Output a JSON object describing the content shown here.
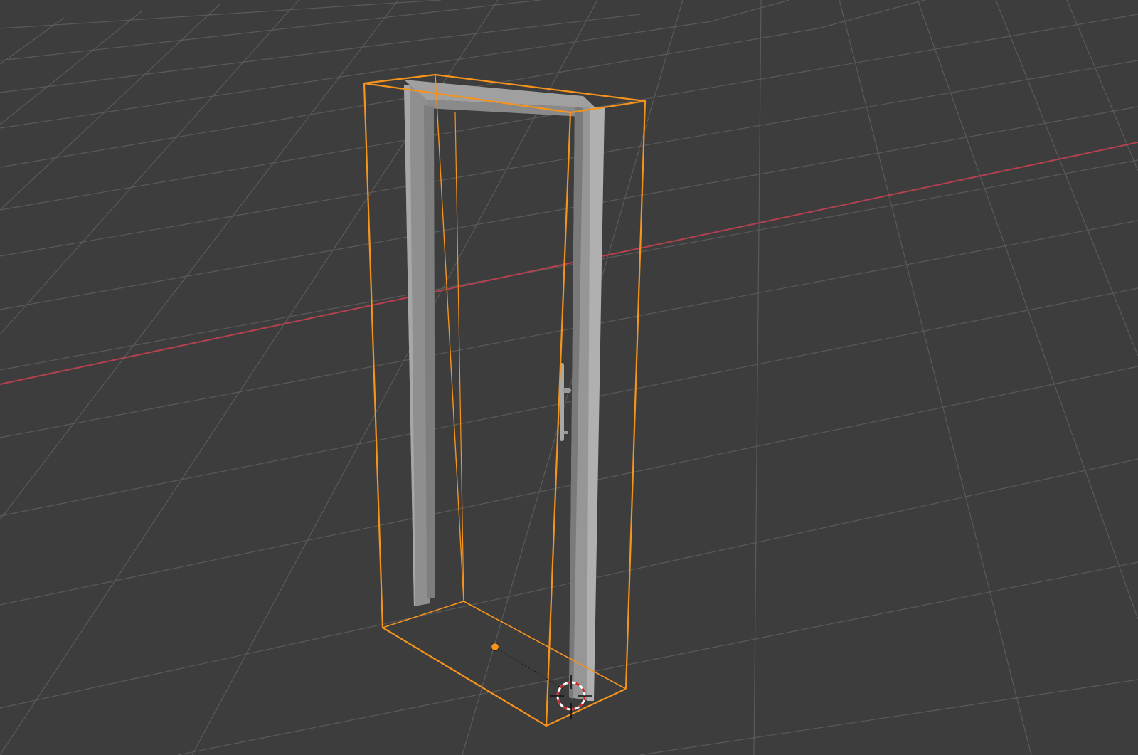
{
  "app": {
    "editor": "3D Viewport"
  },
  "scene": {
    "background_color": "#3d3d3d",
    "grid_color": "#5a5a5a",
    "x_axis_color": "#b5404f",
    "selected_outline_color": "#f5931d",
    "origin_color": "#f5931d",
    "mesh_color": "#9b9b9b",
    "cursor_colors": [
      "#ffffff",
      "#cc2a2a"
    ],
    "active_object": {
      "type": "door-frame",
      "selected": true,
      "show_bounds": true
    }
  }
}
